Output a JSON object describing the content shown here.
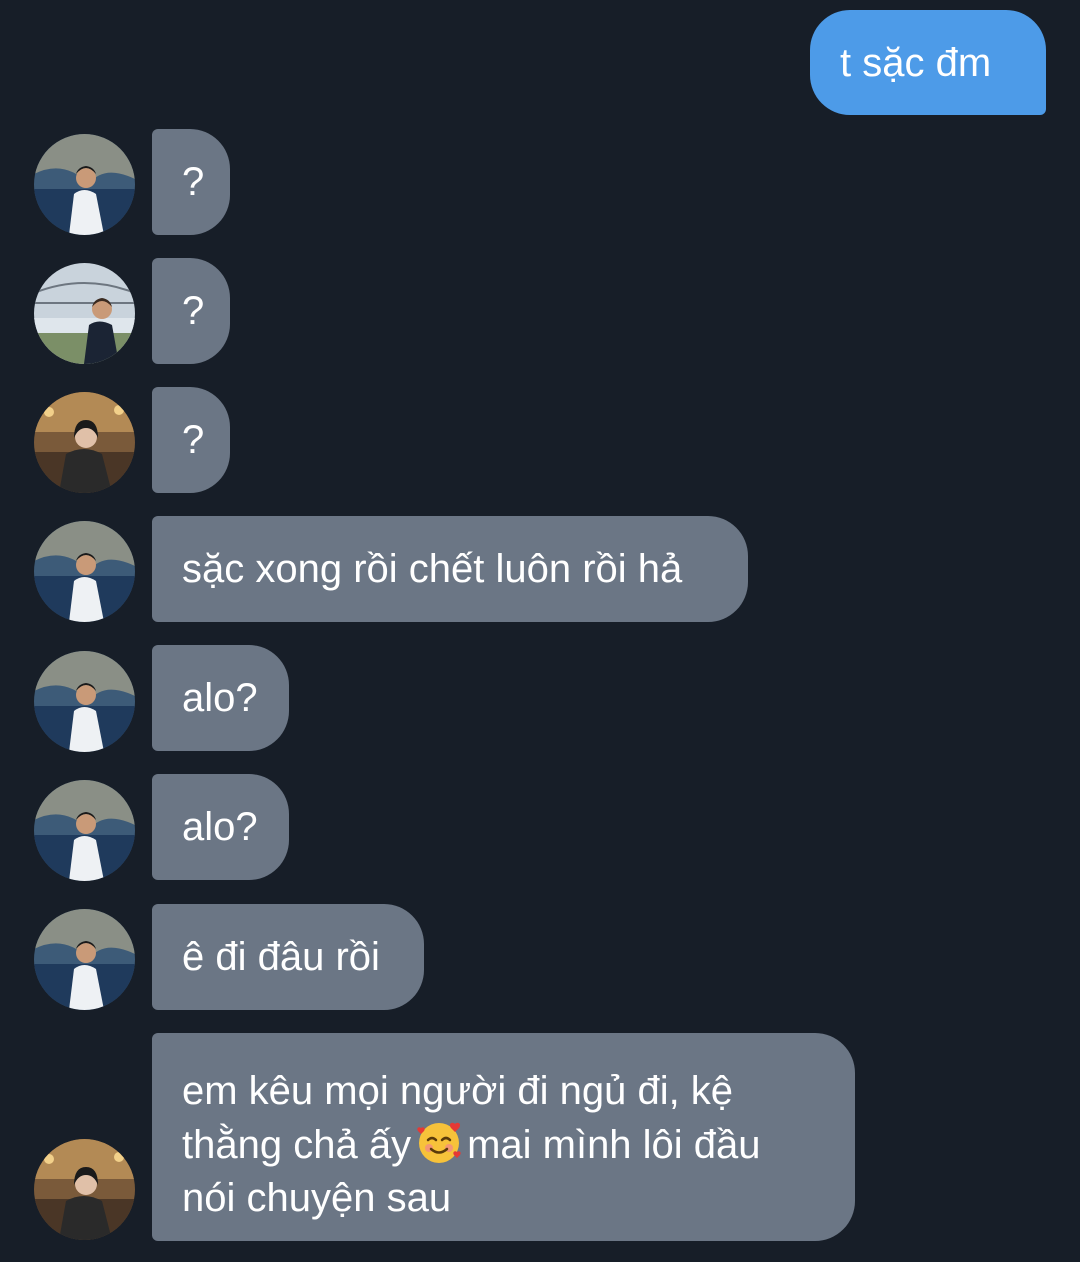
{
  "conversation": {
    "outgoing": [
      {
        "text": "t sặc đm"
      }
    ],
    "incoming": [
      {
        "sender": "avatar-sea",
        "text": "?"
      },
      {
        "sender": "avatar-bridge",
        "text": "?"
      },
      {
        "sender": "avatar-cafe",
        "text": "?"
      },
      {
        "sender": "avatar-sea",
        "text": "sặc xong rồi chết luôn rồi hả"
      },
      {
        "sender": "avatar-sea",
        "text": "alo?"
      },
      {
        "sender": "avatar-sea",
        "text": "alo?"
      },
      {
        "sender": "avatar-sea",
        "text": "ê đi đâu rồi"
      },
      {
        "sender": "avatar-cafe",
        "line1": "em kêu mọi người đi ngủ đi, kệ",
        "line2a": "thằng chả ấy",
        "emoji": "smiling-face-with-hearts",
        "line2b": "mai mình lôi đầu",
        "line3": "nói chuyện sau"
      }
    ]
  },
  "colors": {
    "background": "#171e28",
    "outgoing_bubble": "#4d9be8",
    "incoming_bubble": "#6b7685",
    "text": "#ffffff"
  }
}
